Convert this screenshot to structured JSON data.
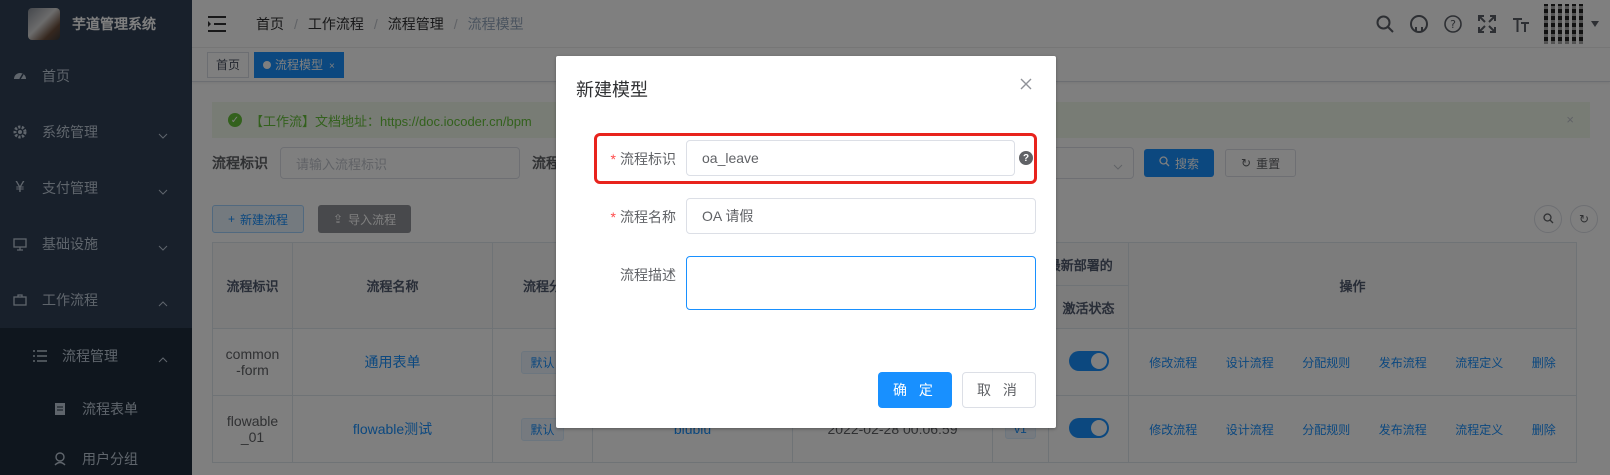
{
  "app": {
    "title": "芋道管理系统"
  },
  "sidebar": {
    "items": [
      {
        "label": "首页",
        "icon": "dashboard-icon"
      },
      {
        "label": "系统管理",
        "icon": "gear-icon"
      },
      {
        "label": "支付管理",
        "icon": "yen-icon"
      },
      {
        "label": "基础设施",
        "icon": "monitor-icon"
      },
      {
        "label": "工作流程",
        "icon": "briefcase-icon"
      }
    ],
    "sub": {
      "label": "流程管理",
      "icon": "list-icon"
    },
    "deep": [
      {
        "label": "流程表单",
        "icon": "form-icon"
      },
      {
        "label": "用户分组",
        "icon": "users-icon"
      }
    ]
  },
  "breadcrumb": [
    "首页",
    "工作流程",
    "流程管理",
    "流程模型"
  ],
  "tags": {
    "home": "首页",
    "active": "流程模型"
  },
  "alert": {
    "text": "【工作流】文档地址：https://doc.iocoder.cn/bpm"
  },
  "search": {
    "label1": "流程标识",
    "placeholder1": "请输入流程标识",
    "label2": "流程",
    "search_btn": "搜索",
    "reset_btn": "重置"
  },
  "toolbar": {
    "new_btn": "新建流程",
    "import_btn": "导入流程"
  },
  "table": {
    "headers": {
      "key": "流程标识",
      "name": "流程名称",
      "category": "流程分",
      "latest": "最新部署的",
      "status": "激活状态",
      "ops": "操作"
    },
    "rows": [
      {
        "key": "common-form",
        "key_line1": "common",
        "key_line2": "-form",
        "name": "通用表单",
        "category": "默认"
      },
      {
        "key": "flowable_01",
        "key_line1": "flowable",
        "key_line2": "_01",
        "name": "flowable测试",
        "category": "默认",
        "partial_name": "blublu",
        "partial_time": "2022-02-28 00:06:59",
        "partial_version": "v1"
      }
    ],
    "ops": [
      "修改流程",
      "设计流程",
      "分配规则",
      "发布流程",
      "流程定义",
      "删除"
    ]
  },
  "dialog": {
    "title": "新建模型",
    "key_label": "流程标识",
    "key_value": "oa_leave",
    "name_label": "流程名称",
    "name_value": "OA 请假",
    "desc_label": "流程描述",
    "desc_value": "",
    "help_glyph": "?",
    "confirm": "确 定",
    "cancel": "取 消"
  },
  "colors": {
    "primary": "#1890ff",
    "sidebar": "#304156",
    "highlight": "#e8231d"
  }
}
